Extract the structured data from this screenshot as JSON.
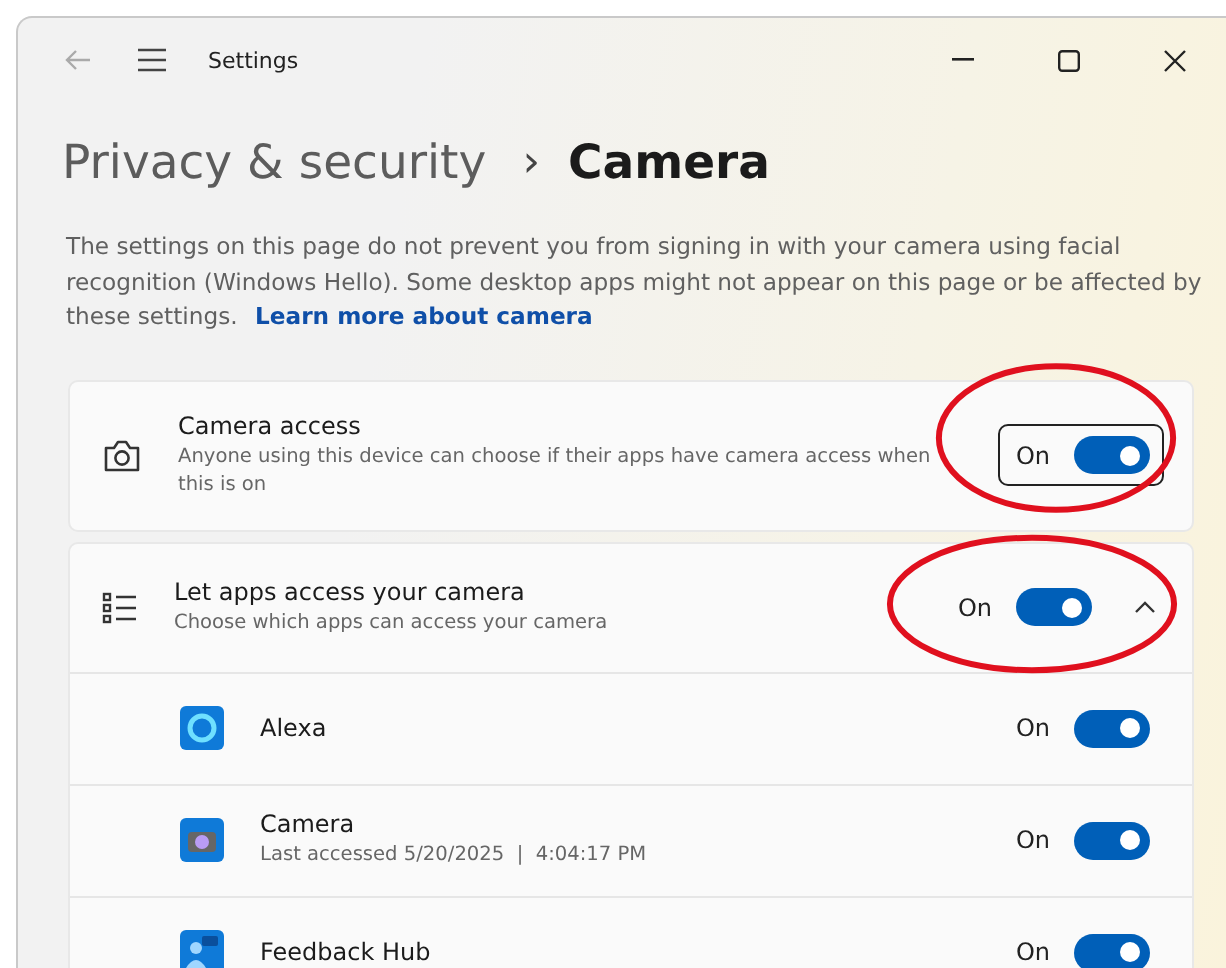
{
  "window": {
    "title": "Settings"
  },
  "breadcrumb": {
    "parent": "Privacy & security",
    "separator": "›",
    "current": "Camera"
  },
  "description": {
    "text": "The settings on this page do not prevent you from signing in with your camera using facial recognition (Windows Hello). Some desktop apps might not appear on this page or be affected by these settings.",
    "link": "Learn more about camera"
  },
  "settings": [
    {
      "kind": "camera",
      "title": "Camera access",
      "subtitle": "Anyone using this device can choose if their apps have camera access when this is on",
      "state": "On",
      "on": true,
      "focused": true,
      "highlighted": true
    },
    {
      "kind": "list",
      "title": "Let apps access your camera",
      "subtitle": "Choose which apps can access your camera",
      "state": "On",
      "on": true,
      "focused": false,
      "highlighted": true,
      "expanded": true,
      "apps": [
        {
          "kind": "alexa",
          "name": "Alexa",
          "state": "On",
          "on": true
        },
        {
          "kind": "camera",
          "name": "Camera",
          "detail": "Last accessed 5/20/2025  |  4:04:17 PM",
          "state": "On",
          "on": true
        },
        {
          "kind": "feedback",
          "name": "Feedback Hub",
          "state": "On",
          "on": true
        }
      ]
    }
  ]
}
